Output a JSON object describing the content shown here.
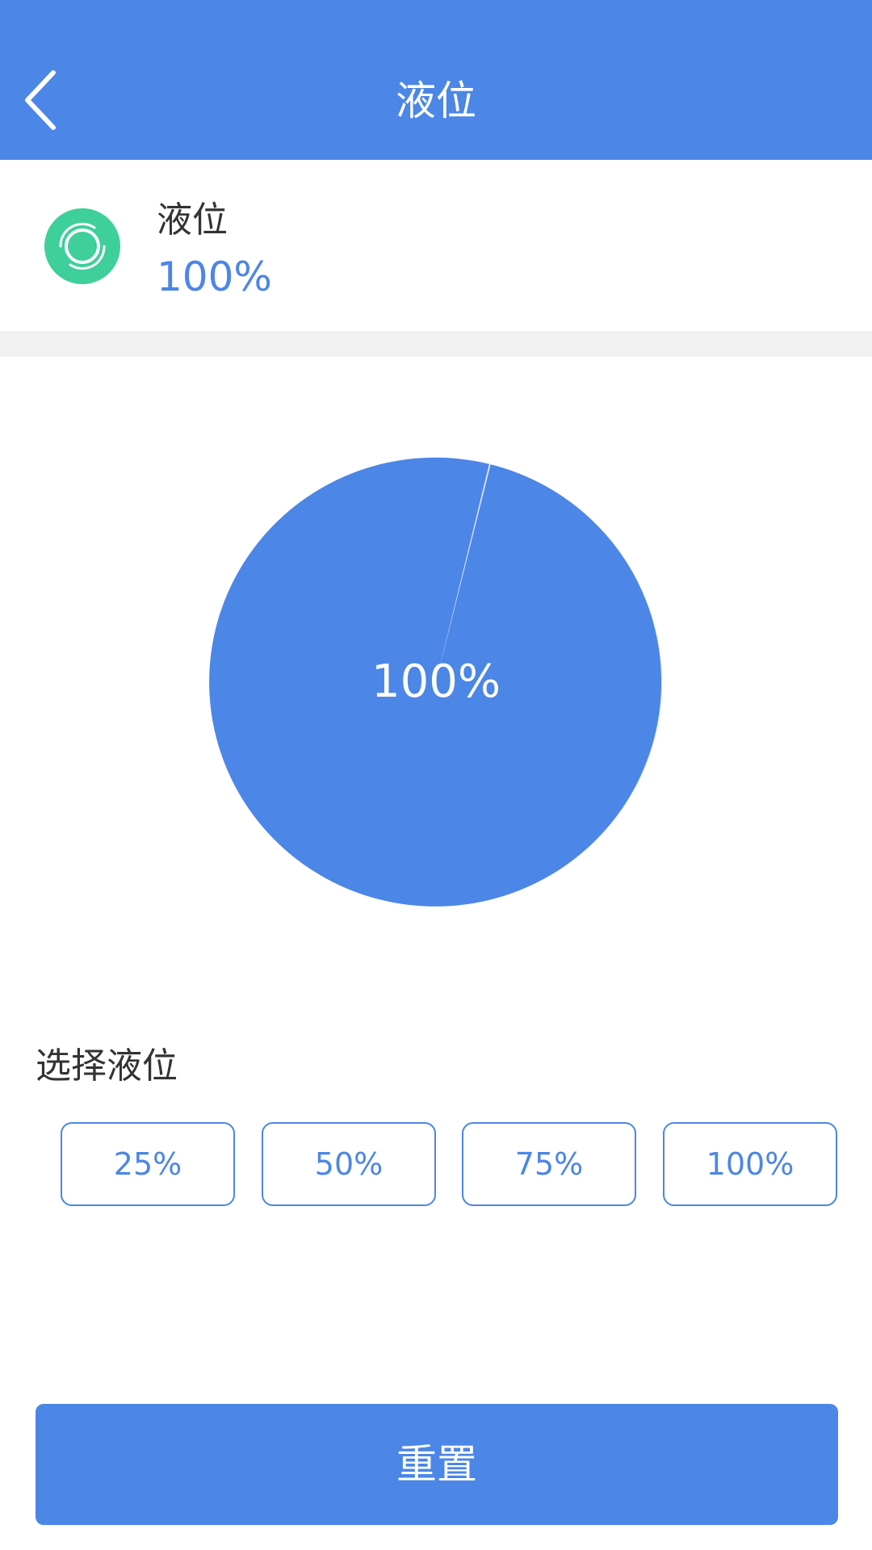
{
  "header": {
    "title": "液位",
    "back_icon": "chevron-left-icon"
  },
  "status": {
    "icon": "ring-target-icon",
    "icon_color": "#3ecf9a",
    "label": "液位",
    "value": "100%"
  },
  "gauge": {
    "type": "pie",
    "level": 1.0,
    "display_text": "100%",
    "fill_color": "#4c86e6",
    "track_color": "#dde6f5"
  },
  "select": {
    "label": "选择液位",
    "options": [
      "25%",
      "50%",
      "75%",
      "100%"
    ]
  },
  "actions": {
    "reset_label": "重置"
  },
  "colors": {
    "primary": "#4c86e6",
    "divider": "#f1f1f1",
    "text": "#333333"
  }
}
